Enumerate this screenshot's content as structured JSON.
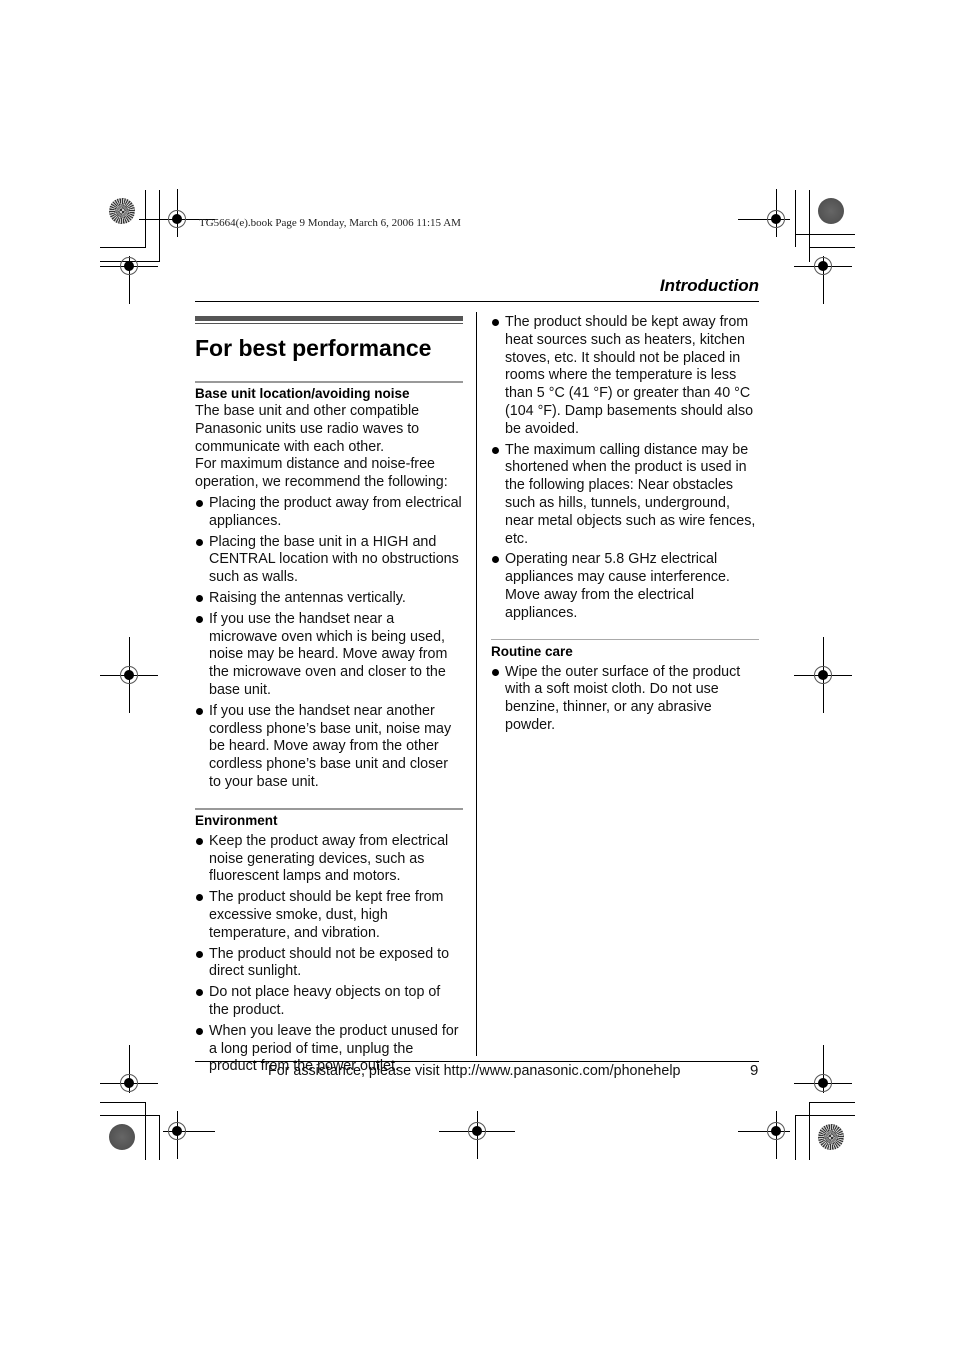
{
  "print_header": "TG5664(e).book  Page 9  Monday, March 6, 2006  11:15 AM",
  "section_title": "Introduction",
  "page_title": "For best performance",
  "sections": {
    "base_unit": {
      "heading": "Base unit location/avoiding noise",
      "intro": [
        "The base unit and other compatible Panasonic units use radio waves to communicate with each other.",
        "For maximum distance and noise-free operation, we recommend the following:"
      ],
      "bullets": [
        "Placing the product away from electrical appliances.",
        "Placing the base unit in a HIGH and CENTRAL location with no obstructions such as walls.",
        "Raising the antennas vertically.",
        "If you use the handset near a microwave oven which is being used, noise may be heard. Move away from the microwave oven and closer to the base unit.",
        "If you use the handset near another cordless phone’s base unit, noise may be heard. Move away from the other cordless phone’s base unit and closer to your base unit."
      ]
    },
    "environment": {
      "heading": "Environment",
      "bullets": [
        "Keep the product away from electrical noise generating devices, such as fluorescent lamps and motors.",
        "The product should be kept free from excessive smoke, dust, high temperature, and vibration.",
        "The product should not be exposed to direct sunlight.",
        "Do not place heavy objects on top of the product.",
        "When you leave the product unused for a long period of time, unplug the product from the power outlet.",
        "The product should be kept away from heat sources such as heaters, kitchen stoves, etc. It should not be placed in rooms where the temperature is less than 5 °C (41 °F) or greater than 40 °C (104 °F). Damp basements should also be avoided.",
        "The maximum calling distance may be shortened when the product is used in the following places: Near obstacles such as hills, tunnels, underground, near metal objects such as wire fences, etc.",
        "Operating near 5.8 GHz electrical appliances may cause interference. Move away from the electrical appliances."
      ]
    },
    "routine_care": {
      "heading": "Routine care",
      "bullets": [
        "Wipe the outer surface of the product with a soft moist cloth. Do not use benzine, thinner, or any abrasive powder."
      ]
    }
  },
  "footer": {
    "text": "For assistance, please visit http://www.panasonic.com/phonehelp",
    "page_number": "9"
  }
}
